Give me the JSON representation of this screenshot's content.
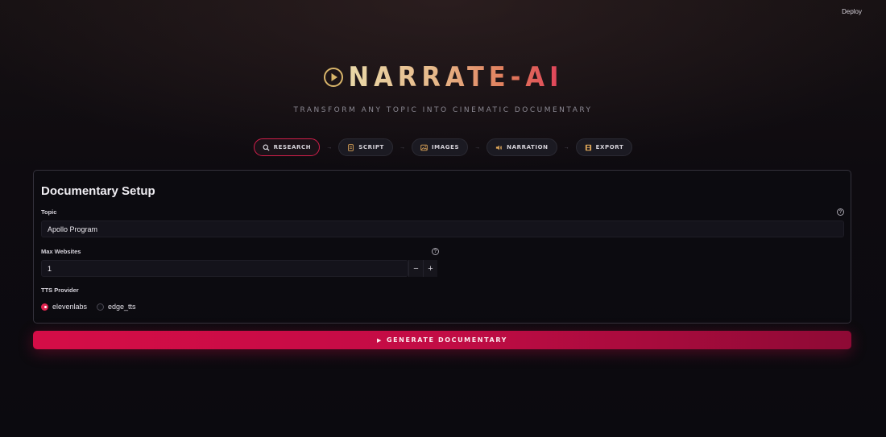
{
  "header": {
    "deploy_label": "Deploy"
  },
  "hero": {
    "title": "NARRATE-AI",
    "subtitle": "TRANSFORM ANY TOPIC INTO CINEMATIC DOCUMENTARY"
  },
  "steps": [
    {
      "label": "RESEARCH",
      "icon": "search-icon",
      "active": true
    },
    {
      "label": "SCRIPT",
      "icon": "document-icon",
      "active": false
    },
    {
      "label": "IMAGES",
      "icon": "image-icon",
      "active": false
    },
    {
      "label": "NARRATION",
      "icon": "speaker-icon",
      "active": false
    },
    {
      "label": "EXPORT",
      "icon": "film-icon",
      "active": false
    }
  ],
  "step_separator": "→",
  "setup": {
    "heading": "Documentary Setup",
    "topic_label": "Topic",
    "topic_value": "Apollo Program",
    "max_websites_label": "Max Websites",
    "max_websites_value": "1",
    "minus": "−",
    "plus": "+",
    "tts_label": "TTS Provider",
    "tts_options": [
      "elevenlabs",
      "edge_tts"
    ],
    "tts_selected": "elevenlabs",
    "help_glyph": "?"
  },
  "generate": {
    "icon": "play-triangle-icon",
    "label": "GENERATE DOCUMENTARY"
  },
  "colors": {
    "accent": "#d50d47",
    "title_gold": "#e9d8a8",
    "background": "#0e0b10"
  }
}
